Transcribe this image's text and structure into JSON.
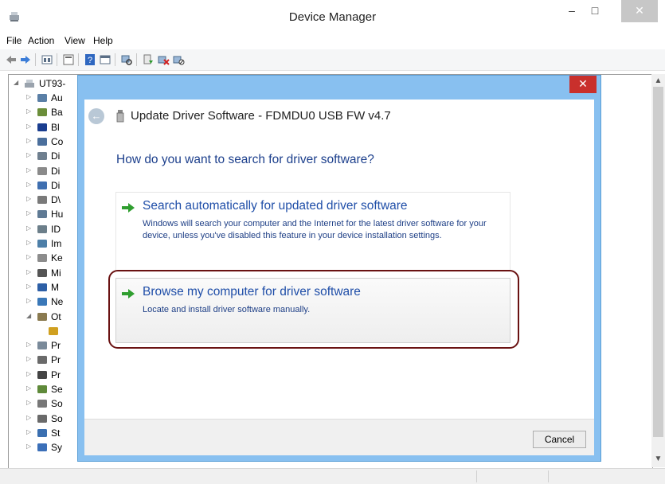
{
  "window": {
    "title": "Device Manager",
    "minimize_glyph": "–",
    "maximize_glyph": "□",
    "close_glyph": "✕"
  },
  "menu": [
    "File",
    "Action",
    "View",
    "Help"
  ],
  "toolbar_icons": [
    "back-icon",
    "forward-icon",
    "properties-icon",
    "show-hide-icon",
    "help-icon",
    "view-icon",
    "scan-hardware-icon",
    "update-driver-icon",
    "uninstall-icon",
    "disable-icon"
  ],
  "tree": {
    "root": "UT93-",
    "items": [
      {
        "label": "Au",
        "icon": "speaker-icon",
        "expander": "▷"
      },
      {
        "label": "Ba",
        "icon": "battery-icon",
        "expander": "▷"
      },
      {
        "label": "Bl",
        "icon": "bluetooth-icon",
        "expander": "▷"
      },
      {
        "label": "Co",
        "icon": "computer-icon",
        "expander": "▷"
      },
      {
        "label": "Di",
        "icon": "disk-icon",
        "expander": "▷"
      },
      {
        "label": "Di",
        "icon": "drive-icon",
        "expander": "▷"
      },
      {
        "label": "Di",
        "icon": "display-icon",
        "expander": "▷"
      },
      {
        "label": "D\\",
        "icon": "dvd-icon",
        "expander": "▷"
      },
      {
        "label": "Hu",
        "icon": "hid-icon",
        "expander": "▷"
      },
      {
        "label": "ID",
        "icon": "ide-icon",
        "expander": "▷"
      },
      {
        "label": "Im",
        "icon": "imaging-icon",
        "expander": "▷"
      },
      {
        "label": "Ke",
        "icon": "keyboard-icon",
        "expander": "▷"
      },
      {
        "label": "Mi",
        "icon": "mouse-icon",
        "expander": "▷"
      },
      {
        "label": "M",
        "icon": "monitor-icon",
        "expander": "▷"
      },
      {
        "label": "Ne",
        "icon": "network-icon",
        "expander": "▷"
      },
      {
        "label": "Ot",
        "icon": "other-devices-icon",
        "expander": "◢"
      },
      {
        "label": "",
        "icon": "warning-device-icon",
        "expander": ""
      },
      {
        "label": "Pr",
        "icon": "printer-icon",
        "expander": "▷"
      },
      {
        "label": "Pr",
        "icon": "print-queue-icon",
        "expander": "▷"
      },
      {
        "label": "Pr",
        "icon": "processor-icon",
        "expander": "▷"
      },
      {
        "label": "Se",
        "icon": "security-icon",
        "expander": "▷"
      },
      {
        "label": "So",
        "icon": "software-icon",
        "expander": "▷"
      },
      {
        "label": "So",
        "icon": "sound-icon",
        "expander": "▷"
      },
      {
        "label": "St",
        "icon": "storage-icon",
        "expander": "▷"
      },
      {
        "label": "Sy",
        "icon": "system-icon",
        "expander": "▷"
      }
    ]
  },
  "dialog": {
    "title": "Update Driver Software - FDMDU0 USB FW v4.7",
    "question": "How do you want to search for driver software?",
    "options": [
      {
        "title": "Search automatically for updated driver software",
        "description": "Windows will search your computer and the Internet for the latest driver software for your device, unless you've disabled this feature in your device installation settings."
      },
      {
        "title": "Browse my computer for driver software",
        "description": "Locate and install driver software manually."
      }
    ],
    "cancel_label": "Cancel",
    "close_glyph": "✕",
    "back_glyph": "←"
  },
  "colors": {
    "dialog_frame": "#88c0f0",
    "link_blue": "#1f4ea8",
    "highlight_ring": "#6a1212",
    "close_red": "#c9302c"
  }
}
